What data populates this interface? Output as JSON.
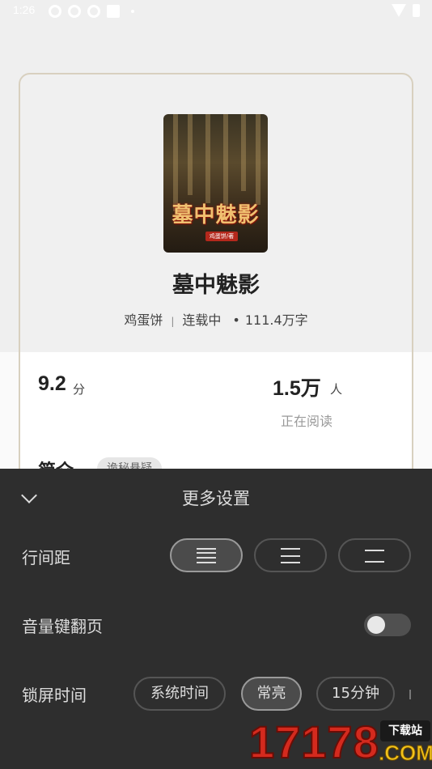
{
  "status_bar": {
    "time": "1:26"
  },
  "book": {
    "cover_title": "墓中魅影",
    "cover_author": "鸡蛋饼/著",
    "title": "墓中魅影",
    "author": "鸡蛋饼",
    "status": "连载中",
    "word_count": "111.4万字",
    "score": "9.2",
    "score_unit": "分",
    "readers": "1.5万",
    "readers_unit": "人",
    "readers_label": "正在阅读",
    "intro_label": "简介",
    "genre_tag": "诡秘悬疑"
  },
  "settings": {
    "title": "更多设置",
    "line_spacing": {
      "label": "行间距",
      "options": [
        "compact-spacing-icon",
        "medium-spacing-icon",
        "loose-spacing-icon"
      ],
      "selected": 0
    },
    "volume_key_page_turn": {
      "label": "音量键翻页",
      "enabled": false
    },
    "lock_screen": {
      "label": "锁屏时间",
      "options": [
        "系统时间",
        "常亮",
        "15分钟"
      ],
      "selected": 1
    }
  },
  "watermark": {
    "number": "17178",
    "site": ".COM",
    "badge": "下载站"
  }
}
